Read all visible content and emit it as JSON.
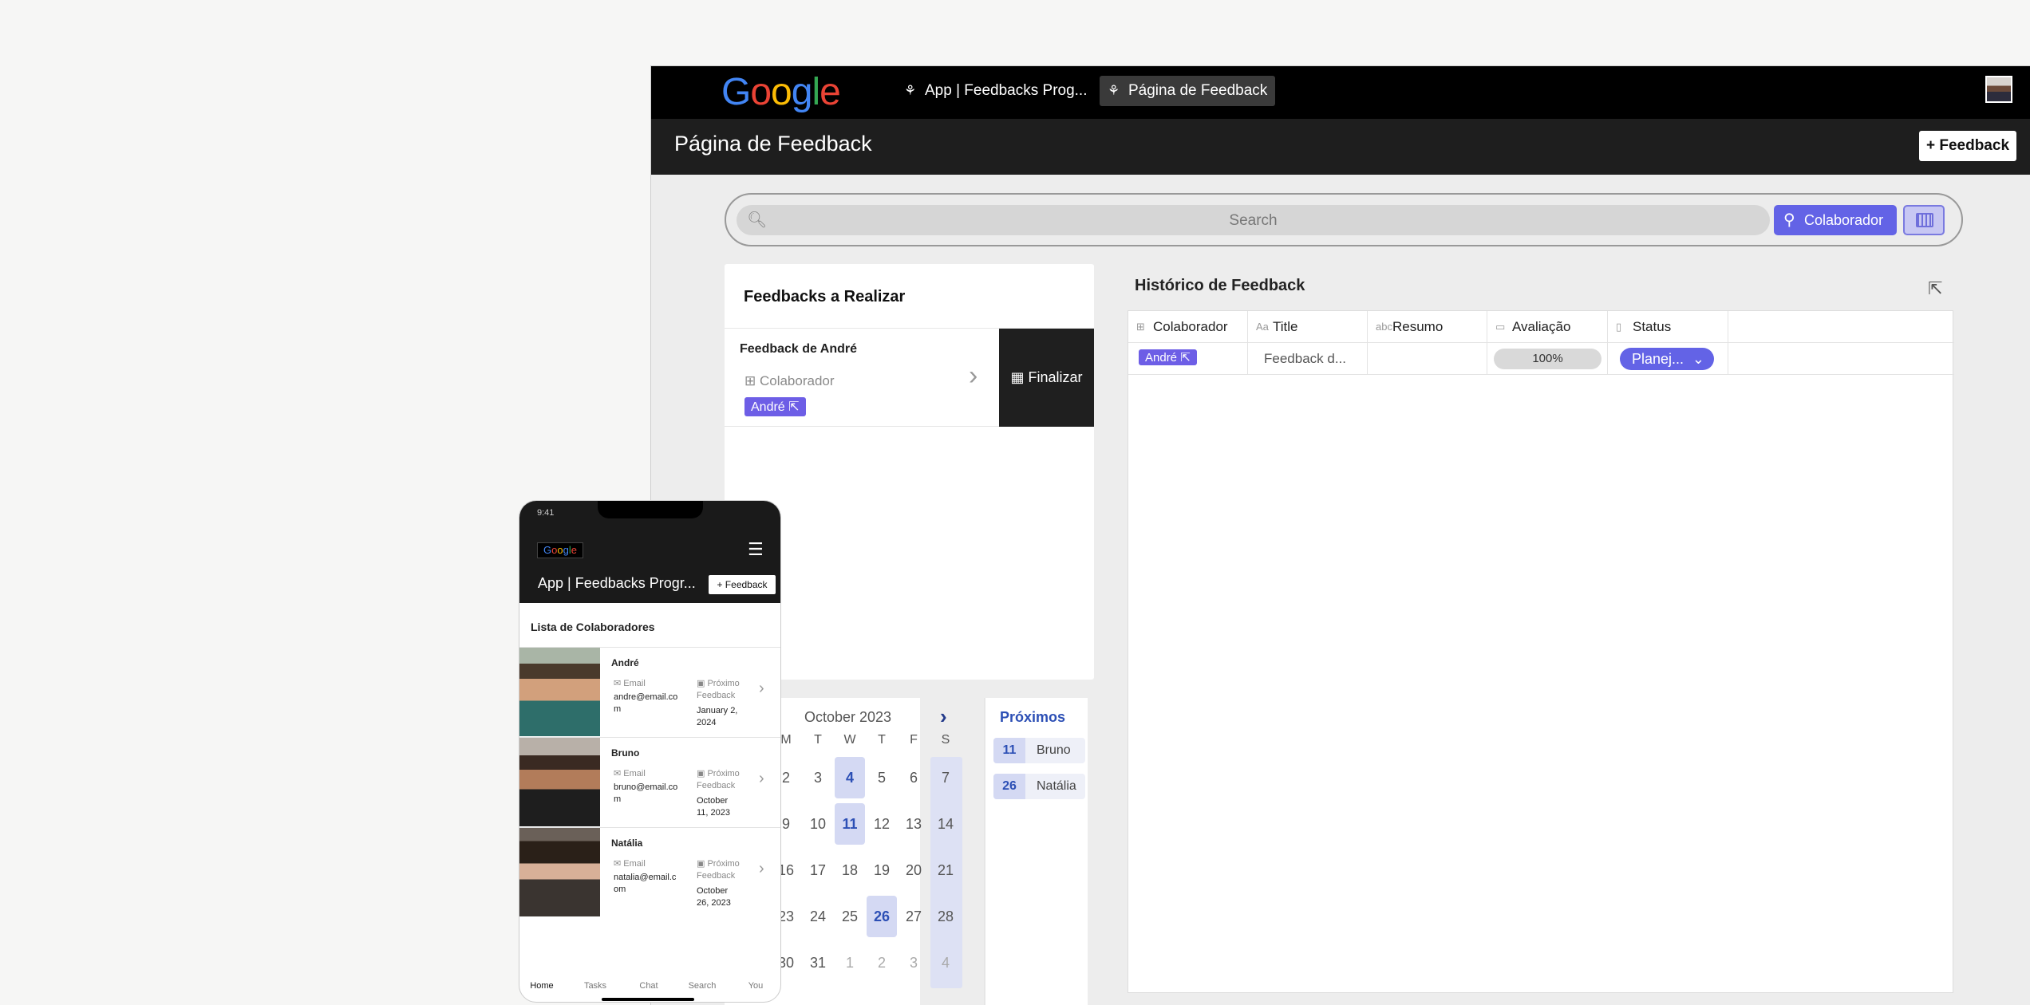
{
  "desktop": {
    "logo": "Google",
    "tabs": [
      {
        "label": "App | Feedbacks Prog..."
      },
      {
        "label": "Página de Feedback"
      }
    ],
    "page_title": "Página de Feedback",
    "new_feedback_button": "+ Feedback",
    "search": {
      "placeholder": "Search",
      "button_label": "Colaborador"
    },
    "todo": {
      "title": "Feedbacks a Realizar",
      "card_title": "Feedback de André",
      "field_label": "Colaborador",
      "chip": "André",
      "finalize_button": "Finalizar"
    },
    "calendar": {
      "month": "October 2023",
      "weekdays": [
        "M",
        "T",
        "W",
        "T",
        "F",
        "S"
      ],
      "weeks": [
        [
          "2",
          "3",
          "4",
          "5",
          "6",
          "7"
        ],
        [
          "9",
          "10",
          "11",
          "12",
          "13",
          "14"
        ],
        [
          "16",
          "17",
          "18",
          "19",
          "20",
          "21"
        ],
        [
          "23",
          "24",
          "25",
          "26",
          "27",
          "28"
        ],
        [
          "30",
          "31",
          "1",
          "2",
          "3",
          "4"
        ]
      ],
      "highlighted": [
        "4",
        "11",
        "26"
      ]
    },
    "upcoming": {
      "title": "Próximos",
      "items": [
        {
          "day": "11",
          "name": "Bruno"
        },
        {
          "day": "26",
          "name": "Natália"
        }
      ]
    },
    "history": {
      "title": "Histórico de Feedback",
      "columns": [
        "Colaborador",
        "Title",
        "Resumo",
        "Avaliação",
        "Status"
      ],
      "rows": [
        {
          "colaborador": "André",
          "title": "Feedback d...",
          "resumo": "",
          "avaliacao": "100%",
          "status": "Planej..."
        }
      ]
    }
  },
  "phone": {
    "time": "9:41",
    "logo": "Google",
    "app_title": "App | Feedbacks Progr...",
    "new_feedback_button": "+ Feedback",
    "list_title": "Lista de Colaboradores",
    "email_label": "Email",
    "next_label": "Próximo Feedback",
    "people": [
      {
        "name": "André",
        "email": "andre@email.com",
        "next": "January 2, 2024"
      },
      {
        "name": "Bruno",
        "email": "bruno@email.com",
        "next": "October 11, 2023"
      },
      {
        "name": "Natália",
        "email": "natalia@email.com",
        "next": "October 26, 2023"
      }
    ],
    "tabs": [
      "Home",
      "Tasks",
      "Chat",
      "Search",
      "You"
    ]
  },
  "colors": {
    "accent": "#6363e6",
    "chip": "#6d5ee6",
    "highlight": "#d4d9f3",
    "dark": "#1e1e1e"
  }
}
